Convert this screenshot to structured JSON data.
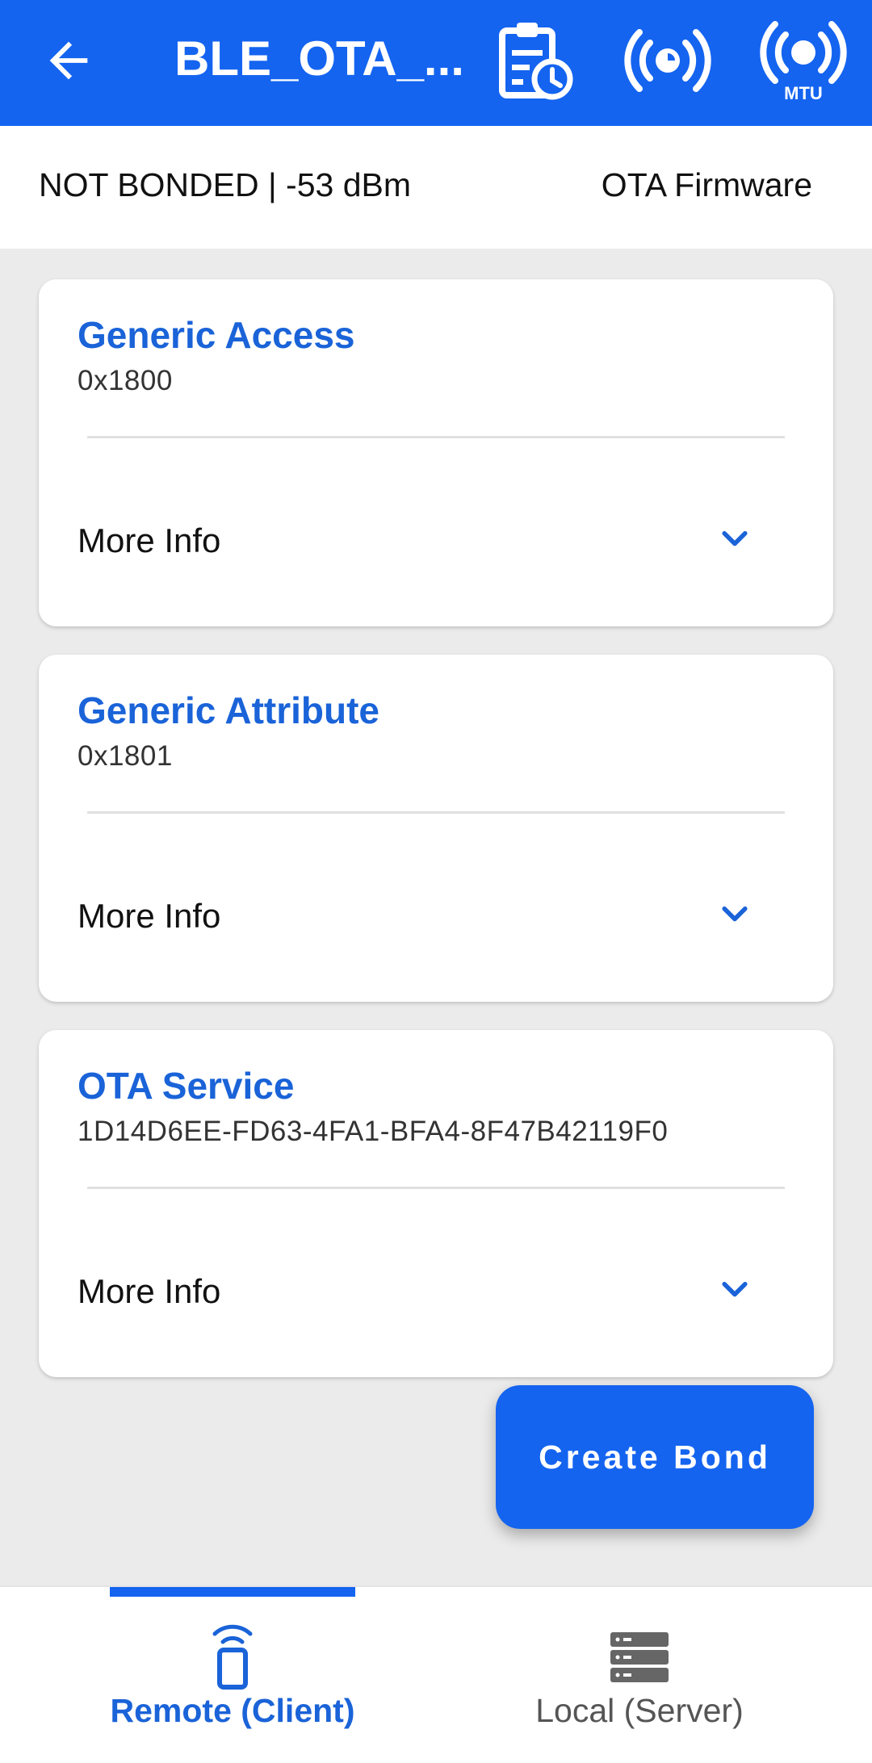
{
  "app_bar": {
    "title": "BLE_OTA_...",
    "mtu_label": "MTU"
  },
  "info_bar": {
    "status": "NOT BONDED | -53 dBm",
    "firmware": "OTA Firmware"
  },
  "services": [
    {
      "name": "Generic Access",
      "uuid": "0x1800",
      "more_label": "More Info"
    },
    {
      "name": "Generic Attribute",
      "uuid": "0x1801",
      "more_label": "More Info"
    },
    {
      "name": "OTA Service",
      "uuid": "1D14D6EE-FD63-4FA1-BFA4-8F47B42119F0",
      "more_label": "More Info"
    }
  ],
  "fab": {
    "label": "Create Bond"
  },
  "bottom_nav": {
    "items": [
      {
        "label": "Remote (Client)",
        "icon": "phone-signal-icon",
        "active": true
      },
      {
        "label": "Local (Server)",
        "icon": "server-icon",
        "active": false
      }
    ]
  },
  "colors": {
    "primary": "#1464f0",
    "accent_text": "#1a63d8",
    "background": "#ebebeb"
  }
}
